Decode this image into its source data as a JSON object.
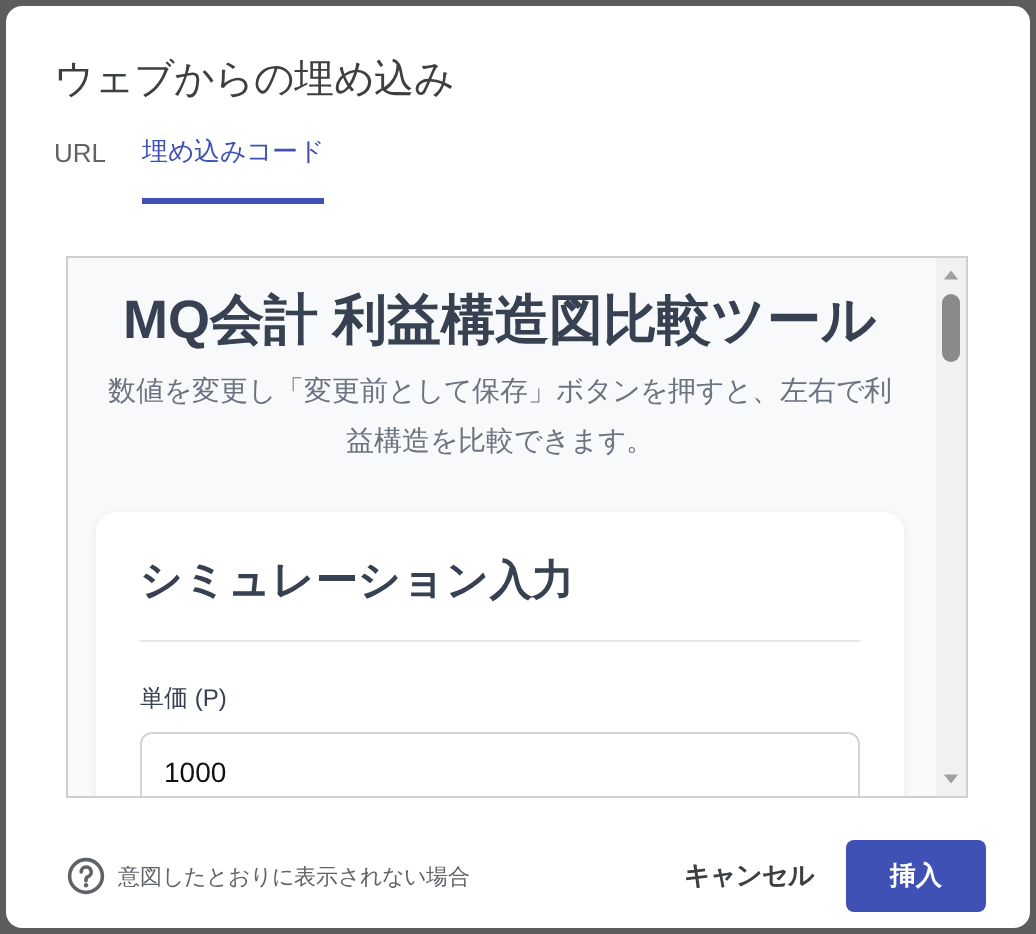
{
  "dialog": {
    "title": "ウェブからの埋め込み"
  },
  "tabs": [
    {
      "label": "URL",
      "selected": false
    },
    {
      "label": "埋め込みコード",
      "selected": true
    }
  ],
  "preview": {
    "title": "MQ会計 利益構造図比較ツール",
    "description": "数値を変更し「変更前として保存」ボタンを押すと、左右で利益構造を比較できます。",
    "card": {
      "title": "シミュレーション入力",
      "fields": [
        {
          "label": "単価 (P)",
          "value": "1000"
        }
      ]
    }
  },
  "footer": {
    "help_link": "意図したとおりに表示されない場合",
    "buttons": [
      {
        "label": "キャンセル",
        "kind": "text"
      },
      {
        "label": "挿入",
        "kind": "primary"
      }
    ]
  }
}
